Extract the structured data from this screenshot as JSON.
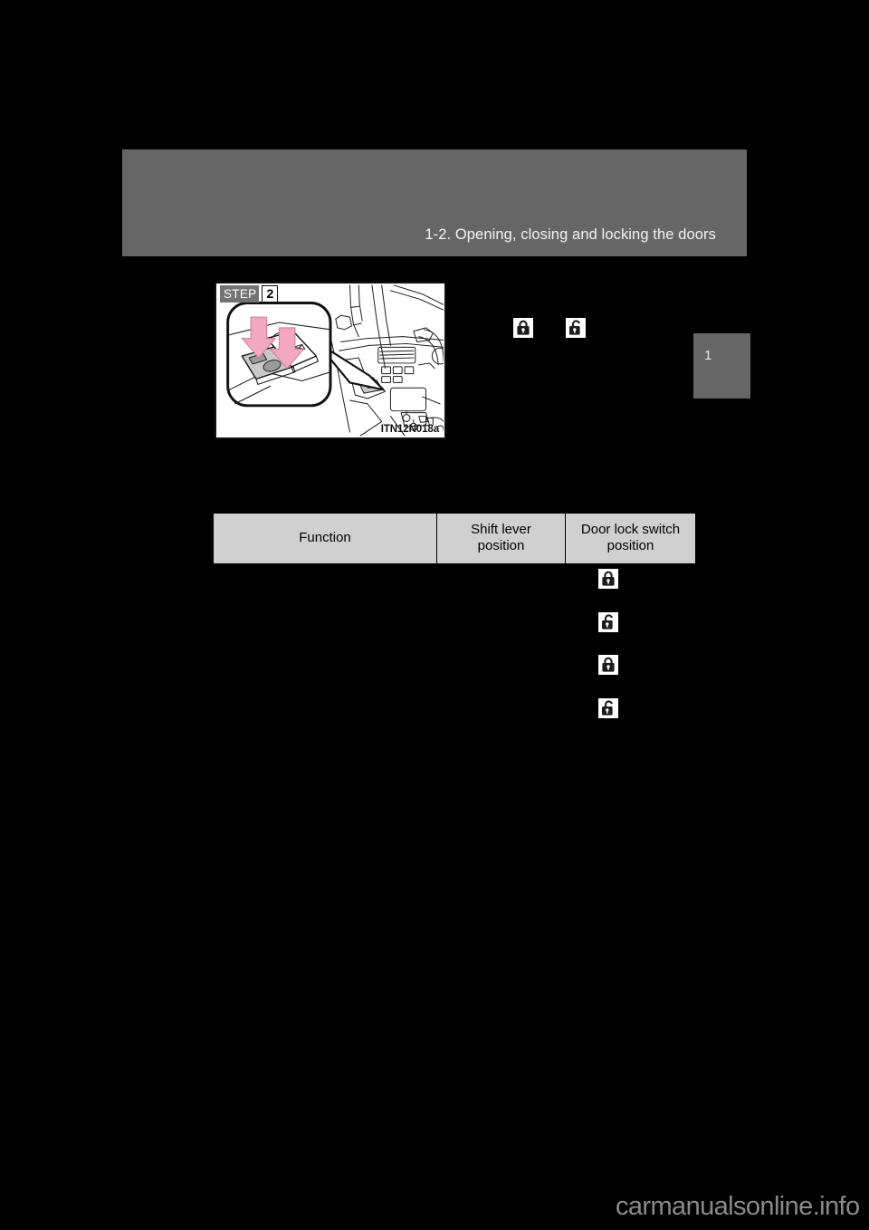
{
  "page": {
    "background_color": "#000000",
    "band_color": "#666666"
  },
  "header": {
    "title": "1-2. Opening, closing and locking the doors"
  },
  "chapter_tab": {
    "number": "1"
  },
  "illustration": {
    "step_label": "STEP",
    "step_number": "2",
    "caption": "ITN12N018a",
    "description": "Driver door lock switch and key illustration with two pink arrows indicating press points on the door lock switch in the vehicle interior",
    "arrow_color": "#f4a7c0"
  },
  "inline_icons": [
    {
      "name": "lock-icon",
      "state": "locked"
    },
    {
      "name": "unlock-icon",
      "state": "unlocked"
    }
  ],
  "table": {
    "columns": [
      {
        "label": "Function"
      },
      {
        "label": "Shift lever\nposition"
      },
      {
        "label": "Door lock switch\nposition"
      }
    ],
    "column_labels": {
      "function": "Function",
      "shift_lever_line1": "Shift lever",
      "shift_lever_line2": "position",
      "door_lock_line1": "Door lock switch",
      "door_lock_line2": "position"
    }
  },
  "icon_column": [
    {
      "name": "lock-icon",
      "state": "locked"
    },
    {
      "name": "unlock-icon",
      "state": "unlocked"
    },
    {
      "name": "lock-icon",
      "state": "locked"
    },
    {
      "name": "unlock-icon",
      "state": "unlocked"
    }
  ],
  "footer": {
    "watermark": "carmanualsonline.info"
  }
}
